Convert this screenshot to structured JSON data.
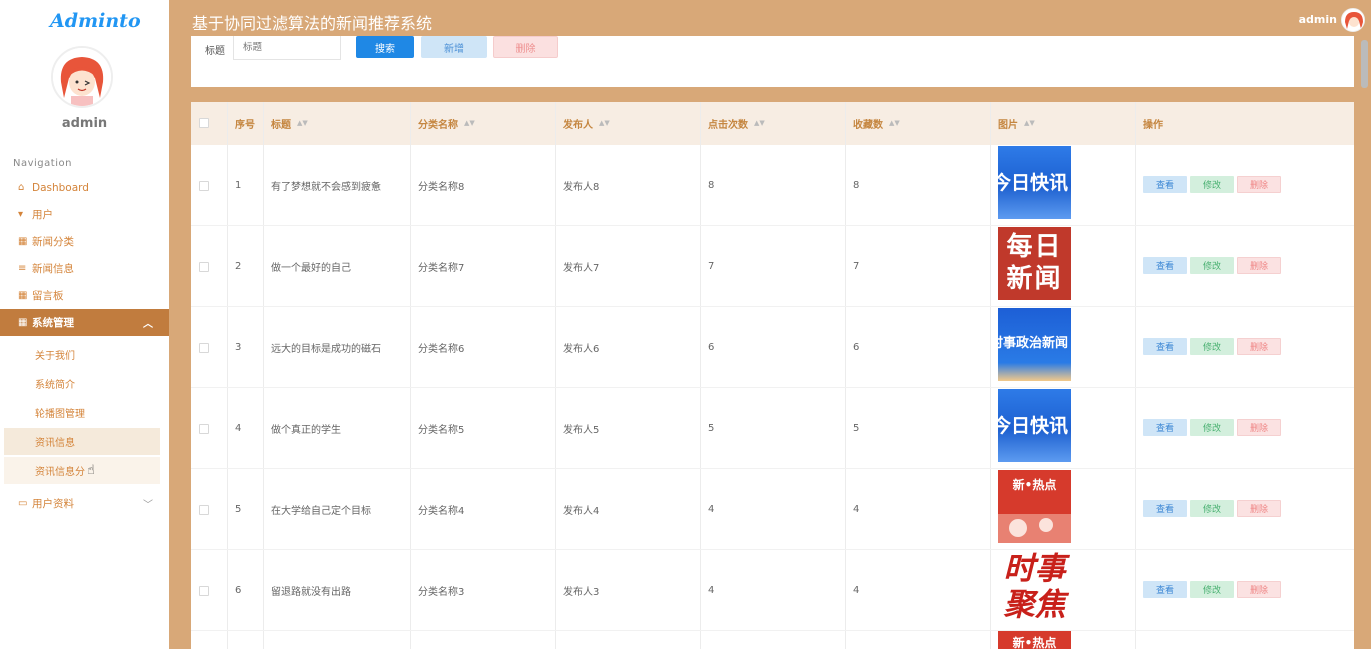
{
  "app": {
    "logo": "Adminto",
    "title": "基于协同过滤算法的新闻推荐系统",
    "username": "admin"
  },
  "sidebar": {
    "username": "admin",
    "nav_title": "Navigation",
    "items": [
      {
        "label": "Dashboard",
        "icon": "home-icon"
      },
      {
        "label": "用户",
        "icon": "user-icon"
      },
      {
        "label": "新闻分类",
        "icon": "grid-icon"
      },
      {
        "label": "新闻信息",
        "icon": "list-icon"
      },
      {
        "label": "留言板",
        "icon": "grid-icon"
      },
      {
        "label": "系统管理",
        "icon": "grid-icon"
      },
      {
        "label": "用户资料",
        "icon": "card-icon"
      }
    ],
    "sub_items": [
      {
        "label": "关于我们"
      },
      {
        "label": "系统简介"
      },
      {
        "label": "轮播图管理"
      },
      {
        "label": "资讯信息"
      },
      {
        "label": "资讯信息分"
      }
    ]
  },
  "search": {
    "label": "标题",
    "placeholder": "标题",
    "search_button": "搜索",
    "add_button": "新增",
    "delete_button": "删除"
  },
  "table": {
    "headers": [
      "序号",
      "标题",
      "分类名称",
      "发布人",
      "点击次数",
      "收藏数",
      "图片",
      "操作"
    ],
    "rows": [
      {
        "index": "1",
        "title": "有了梦想就不会感到疲惫",
        "category": "分类名称8",
        "publisher": "发布人8",
        "clicks": "8",
        "favorites": "8",
        "image_text": "今日快讯"
      },
      {
        "index": "2",
        "title": "做一个最好的自己",
        "category": "分类名称7",
        "publisher": "发布人7",
        "clicks": "7",
        "favorites": "7",
        "image_text": "每日新闻"
      },
      {
        "index": "3",
        "title": "远大的目标是成功的磁石",
        "category": "分类名称6",
        "publisher": "发布人6",
        "clicks": "6",
        "favorites": "6",
        "image_text": "时事政治新闻"
      },
      {
        "index": "4",
        "title": "做个真正的学生",
        "category": "分类名称5",
        "publisher": "发布人5",
        "clicks": "5",
        "favorites": "5",
        "image_text": "今日快讯"
      },
      {
        "index": "5",
        "title": "在大学给自己定个目标",
        "category": "分类名称4",
        "publisher": "发布人4",
        "clicks": "4",
        "favorites": "4",
        "image_text": "新•热点"
      },
      {
        "index": "6",
        "title": "留退路就没有出路",
        "category": "分类名称3",
        "publisher": "发布人3",
        "clicks": "4",
        "favorites": "4",
        "image_text": "时事聚焦"
      }
    ],
    "partial_row_image_text": "新•热点",
    "ops": {
      "view": "查看",
      "edit": "修改",
      "delete": "删除"
    }
  }
}
